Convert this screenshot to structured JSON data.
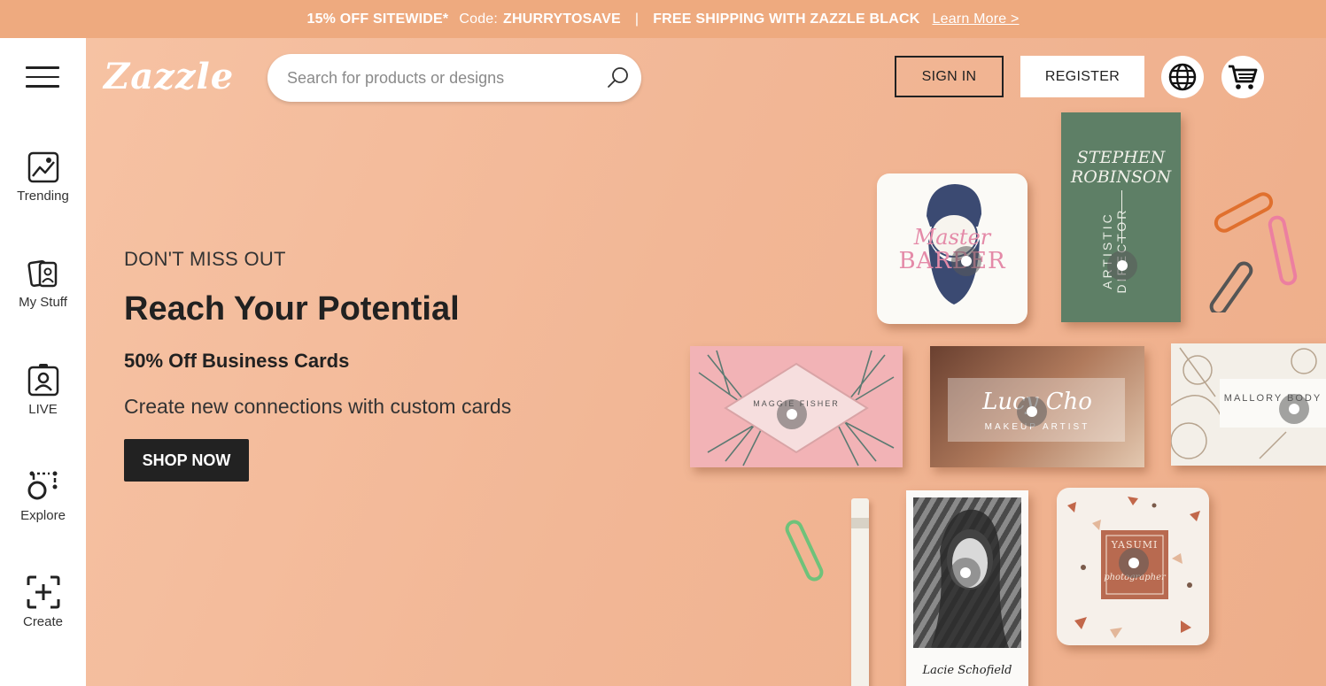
{
  "promo": {
    "offer": "15% OFF SITEWIDE*",
    "code_label": "Code:",
    "code": "ZHURRYTOSAVE",
    "separator": "|",
    "shipping": "FREE SHIPPING WITH ZAZZLE BLACK",
    "learn_more": "Learn More >"
  },
  "header": {
    "logo": "Zazzle",
    "search_placeholder": "Search for products or designs",
    "sign_in": "SIGN IN",
    "register": "REGISTER"
  },
  "sidebar": {
    "items": [
      {
        "label": "Trending",
        "icon": "trending-icon"
      },
      {
        "label": "My Stuff",
        "icon": "my-stuff-icon"
      },
      {
        "label": "LIVE",
        "icon": "live-icon"
      },
      {
        "label": "Explore",
        "icon": "explore-icon"
      },
      {
        "label": "Create",
        "icon": "create-icon"
      }
    ]
  },
  "hero": {
    "eyebrow": "DON'T MISS OUT",
    "headline": "Reach Your Potential",
    "subhead": "50% Off Business Cards",
    "description": "Create new connections with custom cards",
    "cta": "SHOP NOW"
  },
  "cards": {
    "barber": {
      "line1": "Master",
      "line2": "BARBER"
    },
    "green": {
      "name1": "STEPHEN",
      "name2": "ROBINSON",
      "title": "ARTISTIC DIRECTOR"
    },
    "pink": {
      "name": "MAGGIE FISHER"
    },
    "photo": {
      "name": "Lucy Cho",
      "role": "MAKEUP ARTIST"
    },
    "floral": {
      "name": "MALLORY BODY"
    },
    "bw": {
      "name": "Lacie Schofield"
    },
    "terrazzo": {
      "name": "YASUMI",
      "role": "photographer"
    }
  },
  "colors": {
    "promo_bg": "#eeaa7f",
    "hero_bg": "#f2b796",
    "dark": "#222222",
    "green_card": "#5e7f66"
  }
}
